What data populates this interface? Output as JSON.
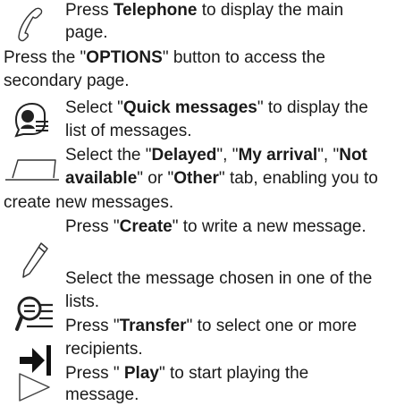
{
  "steps": [
    {
      "icon": "telephone-handset-icon",
      "lines": [
        [
          "Press ",
          {
            "b": "Telephone"
          },
          " to display the main"
        ],
        [
          "page."
        ]
      ]
    },
    {
      "icon": null,
      "lines": [
        [
          "Press the \"",
          {
            "b": "OPTIONS"
          },
          "\" button to access the"
        ],
        [
          "secondary page."
        ]
      ]
    },
    {
      "icon": "quick-messages-icon",
      "lines": [
        [
          "Select \"",
          {
            "b": "Quick messages"
          },
          "\" to display the"
        ],
        [
          "list of messages."
        ]
      ]
    },
    {
      "icon": "message-tab-icon",
      "lines": [
        [
          "Select the \"",
          {
            "b": "Delayed"
          },
          "\", \"",
          {
            "b": "My arrival"
          },
          "\", \"",
          {
            "b": "Not"
          }
        ],
        [
          {
            "b": "available"
          },
          "\" or \"",
          {
            "b": "Other"
          },
          "\" tab, enabling you to"
        ],
        [
          "create new messages."
        ]
      ]
    },
    {
      "icon": "pencil-create-icon",
      "lines": [
        [
          "Press \"",
          {
            "b": "Create"
          },
          "\" to write a new message."
        ]
      ]
    },
    {
      "icon": "select-message-search-icon",
      "lines": [
        [
          "Select the message chosen in one of the"
        ],
        [
          "lists."
        ]
      ]
    },
    {
      "icon": "transfer-arrow-icon",
      "lines": [
        [
          "Press \"",
          {
            "b": "Transfer"
          },
          "\" to select one or more"
        ],
        [
          "recipients."
        ]
      ]
    },
    {
      "icon": "play-triangle-icon",
      "lines": [
        [
          "Press \" ",
          {
            "b": "Play"
          },
          "\" to start playing the"
        ],
        [
          "message."
        ]
      ]
    }
  ]
}
